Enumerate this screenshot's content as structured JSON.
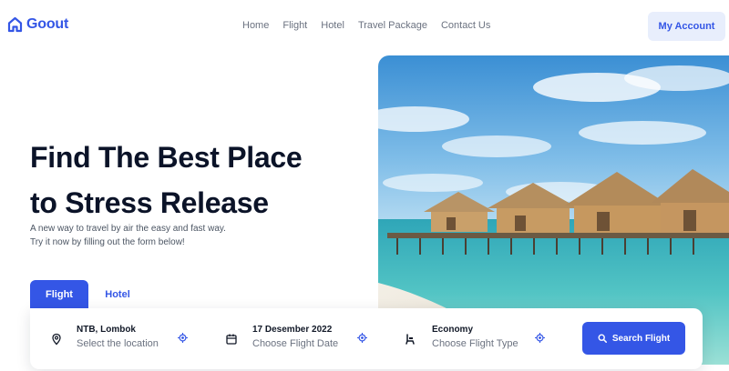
{
  "brand": {
    "name": "Goout",
    "color": "#3456e6"
  },
  "nav": {
    "items": [
      "Home",
      "Flight",
      "Hotel",
      "Travel Package",
      "Contact Us"
    ]
  },
  "account": {
    "label": "My Account"
  },
  "hero": {
    "title_line1": "Find The Best Place",
    "title_line2": "to Stress Release",
    "subtitle_line1": "A new way to travel by air the easy and fast way.",
    "subtitle_line2": "Try it now by filling out the form below!"
  },
  "tabs": [
    {
      "label": "Flight",
      "active": true
    },
    {
      "label": "Hotel",
      "active": false
    }
  ],
  "search": {
    "location": {
      "value": "NTB, Lombok",
      "placeholder": "Select the location",
      "icon": "location-pin-icon"
    },
    "date": {
      "value": "17 Desember 2022",
      "placeholder": "Choose Flight Date",
      "icon": "calendar-icon"
    },
    "class": {
      "value": "Economy",
      "placeholder": "Choose Flight Type",
      "icon": "seat-icon"
    },
    "button_label": "Search Flight"
  }
}
